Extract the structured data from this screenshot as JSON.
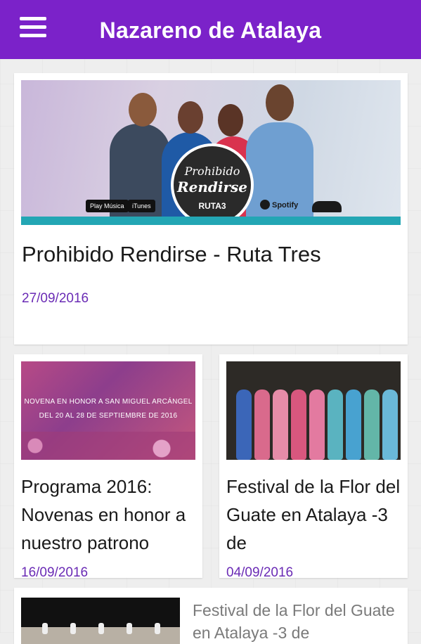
{
  "app": {
    "title": "Nazareno de Atalaya",
    "theme_color": "#7b22c9",
    "menu_icon": "hamburger-menu-icon"
  },
  "cards": [
    {
      "title": "Prohibido Rendirse - Ruta Tres",
      "date": "27/09/2016",
      "image": {
        "badge_line1": "Prohibido",
        "badge_line2": "Rendirse",
        "badge_line3": "RUTA3",
        "store_play": "Play Música",
        "store_itunes": "iTunes",
        "spotify": "Spotify"
      }
    },
    {
      "title": "Programa 2016: Novenas en honor a nuestro patrono",
      "date": "16/09/2016",
      "image": {
        "overlay_line1": "NOVENA EN HONOR A SAN MIGUEL ARCÁNGEL",
        "overlay_line2": "DEL 20 AL 28 DE SEPTIEMBRE DE 2016"
      }
    },
    {
      "title": "Festival de la Flor del Guate en Atalaya -3 de",
      "date": "04/09/2016"
    },
    {
      "title": "Festival de la Flor del Guate en Atalaya -3 de"
    }
  ],
  "date_color": "#6a2bb5"
}
